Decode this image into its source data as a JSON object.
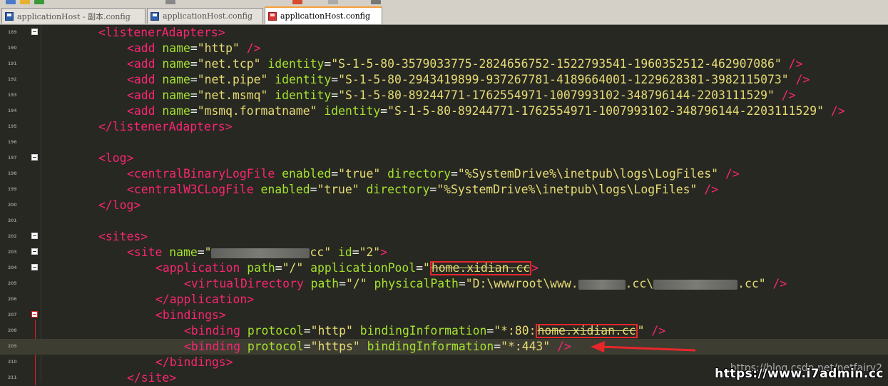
{
  "tabs": [
    {
      "label": "applicationHost - 副本.config",
      "active": false,
      "icon": "save-icon"
    },
    {
      "label": "applicationHost.config",
      "active": false,
      "icon": "save-icon"
    },
    {
      "label": "applicationHost.config",
      "active": true,
      "icon": "save-icon-modified"
    }
  ],
  "colors": {
    "background": "#272822",
    "tag": "#f92672",
    "attribute_name": "#a6e22e",
    "attribute_value": "#e6db74",
    "highlight_box": "#e8262a"
  },
  "lines": [
    {
      "num": "189",
      "fold": true,
      "parts": [
        [
          "tg",
          "<listenerAdapters>"
        ]
      ]
    },
    {
      "num": "190",
      "parts": [
        [
          "tg",
          "<add "
        ],
        [
          "an",
          "name"
        ],
        [
          "pl",
          "="
        ],
        [
          "av",
          "\"http\""
        ],
        [
          "tg",
          " />"
        ]
      ]
    },
    {
      "num": "191",
      "parts": [
        [
          "tg",
          "<add "
        ],
        [
          "an",
          "name"
        ],
        [
          "pl",
          "="
        ],
        [
          "av",
          "\"net.tcp\""
        ],
        [
          "pl",
          " "
        ],
        [
          "an",
          "identity"
        ],
        [
          "pl",
          "="
        ],
        [
          "av",
          "\"S-1-5-80-3579033775-2824656752-1522793541-1960352512-462907086\""
        ],
        [
          "tg",
          " />"
        ]
      ]
    },
    {
      "num": "192",
      "parts": [
        [
          "tg",
          "<add "
        ],
        [
          "an",
          "name"
        ],
        [
          "pl",
          "="
        ],
        [
          "av",
          "\"net.pipe\""
        ],
        [
          "pl",
          " "
        ],
        [
          "an",
          "identity"
        ],
        [
          "pl",
          "="
        ],
        [
          "av",
          "\"S-1-5-80-2943419899-937267781-4189664001-1229628381-3982115073\""
        ],
        [
          "tg",
          " />"
        ]
      ]
    },
    {
      "num": "193",
      "parts": [
        [
          "tg",
          "<add "
        ],
        [
          "an",
          "name"
        ],
        [
          "pl",
          "="
        ],
        [
          "av",
          "\"net.msmq\""
        ],
        [
          "pl",
          " "
        ],
        [
          "an",
          "identity"
        ],
        [
          "pl",
          "="
        ],
        [
          "av",
          "\"S-1-5-80-89244771-1762554971-1007993102-348796144-2203111529\""
        ],
        [
          "tg",
          " />"
        ]
      ]
    },
    {
      "num": "194",
      "parts": [
        [
          "tg",
          "<add "
        ],
        [
          "an",
          "name"
        ],
        [
          "pl",
          "="
        ],
        [
          "av",
          "\"msmq.formatname\""
        ],
        [
          "pl",
          " "
        ],
        [
          "an",
          "identity"
        ],
        [
          "pl",
          "="
        ],
        [
          "av",
          "\"S-1-5-80-89244771-1762554971-1007993102-348796144-2203111529\""
        ],
        [
          "tg",
          " />"
        ]
      ]
    },
    {
      "num": "195",
      "parts": [
        [
          "tg",
          "</listenerAdapters>"
        ]
      ]
    },
    {
      "num": "196",
      "parts": []
    },
    {
      "num": "197",
      "fold": true,
      "parts": [
        [
          "tg",
          "<log>"
        ]
      ]
    },
    {
      "num": "198",
      "parts": [
        [
          "tg",
          "<centralBinaryLogFile "
        ],
        [
          "an",
          "enabled"
        ],
        [
          "pl",
          "="
        ],
        [
          "av",
          "\"true\""
        ],
        [
          "pl",
          " "
        ],
        [
          "an",
          "directory"
        ],
        [
          "pl",
          "="
        ],
        [
          "av",
          "\"%SystemDrive%\\inetpub\\logs\\LogFiles\""
        ],
        [
          "tg",
          " />"
        ]
      ]
    },
    {
      "num": "199",
      "parts": [
        [
          "tg",
          "<centralW3CLogFile "
        ],
        [
          "an",
          "enabled"
        ],
        [
          "pl",
          "="
        ],
        [
          "av",
          "\"true\""
        ],
        [
          "pl",
          " "
        ],
        [
          "an",
          "directory"
        ],
        [
          "pl",
          "="
        ],
        [
          "av",
          "\"%SystemDrive%\\inetpub\\logs\\LogFiles\""
        ],
        [
          "tg",
          " />"
        ]
      ]
    },
    {
      "num": "200",
      "parts": [
        [
          "tg",
          "</log>"
        ]
      ]
    },
    {
      "num": "201",
      "parts": []
    },
    {
      "num": "202",
      "fold": true,
      "parts": [
        [
          "tg",
          "<sites>"
        ]
      ]
    },
    {
      "num": "203",
      "fold": true,
      "parts": [
        [
          "tg",
          "<site "
        ],
        [
          "an",
          "name"
        ],
        [
          "pl",
          "="
        ],
        [
          "av",
          "\""
        ],
        [
          "blur",
          "138"
        ],
        [
          "av",
          "cc\""
        ],
        [
          "pl",
          " "
        ],
        [
          "an",
          "id"
        ],
        [
          "pl",
          "="
        ],
        [
          "av",
          "\"2\""
        ],
        [
          "tg",
          ">"
        ]
      ]
    },
    {
      "num": "204",
      "fold": true,
      "parts": [
        [
          "tg",
          "<application "
        ],
        [
          "an",
          "path"
        ],
        [
          "pl",
          "="
        ],
        [
          "av",
          "\"/\""
        ],
        [
          "pl",
          " "
        ],
        [
          "an",
          "applicationPool"
        ],
        [
          "pl",
          "="
        ],
        [
          "av",
          "\""
        ],
        [
          "box",
          "home.xidian.cc"
        ],
        [
          "tg",
          ">"
        ]
      ]
    },
    {
      "num": "205",
      "parts": [
        [
          "tg",
          "<virtualDirectory "
        ],
        [
          "an",
          "path"
        ],
        [
          "pl",
          "="
        ],
        [
          "av",
          "\"/\""
        ],
        [
          "pl",
          " "
        ],
        [
          "an",
          "physicalPath"
        ],
        [
          "pl",
          "="
        ],
        [
          "av",
          "\"D:\\wwwroot\\www."
        ],
        [
          "blur",
          "66"
        ],
        [
          "av",
          ".cc\\"
        ],
        [
          "blur",
          "118"
        ],
        [
          "av",
          ".cc\""
        ],
        [
          "tg",
          " />"
        ]
      ]
    },
    {
      "num": "206",
      "parts": [
        [
          "tg",
          "</application>"
        ]
      ]
    },
    {
      "num": "207",
      "fold": true,
      "foldRed": true,
      "parts": [
        [
          "tg",
          "<bindings>"
        ]
      ]
    },
    {
      "num": "208",
      "parts": [
        [
          "tg",
          "<binding "
        ],
        [
          "an",
          "protocol"
        ],
        [
          "pl",
          "="
        ],
        [
          "av",
          "\"http\""
        ],
        [
          "pl",
          " "
        ],
        [
          "an",
          "bindingInformation"
        ],
        [
          "pl",
          "="
        ],
        [
          "av",
          "\"*:80:"
        ],
        [
          "box",
          "home.xidian.cc"
        ],
        [
          "av",
          "\""
        ],
        [
          "tg",
          " />"
        ]
      ]
    },
    {
      "num": "209",
      "current": true,
      "parts": [
        [
          "tg",
          "<binding "
        ],
        [
          "an",
          "protocol"
        ],
        [
          "pl",
          "="
        ],
        [
          "av",
          "\"https\""
        ],
        [
          "pl",
          " "
        ],
        [
          "an",
          "bindingInformation"
        ],
        [
          "pl",
          "="
        ],
        [
          "av",
          "\"*:443\""
        ],
        [
          "tg",
          " />"
        ]
      ]
    },
    {
      "num": "210",
      "parts": [
        [
          "tg",
          "</bindings>"
        ]
      ]
    },
    {
      "num": "211",
      "parts": [
        [
          "tg",
          "</site>"
        ]
      ]
    }
  ],
  "indents": [
    0,
    1,
    1,
    1,
    1,
    1,
    0,
    0,
    0,
    1,
    1,
    0,
    0,
    0,
    1,
    2,
    3,
    2,
    2,
    3,
    3,
    2,
    1
  ],
  "watermark": {
    "url": "https://blog.csdn.net/netfairy2",
    "brand": "https://www.i7admin.cc"
  }
}
